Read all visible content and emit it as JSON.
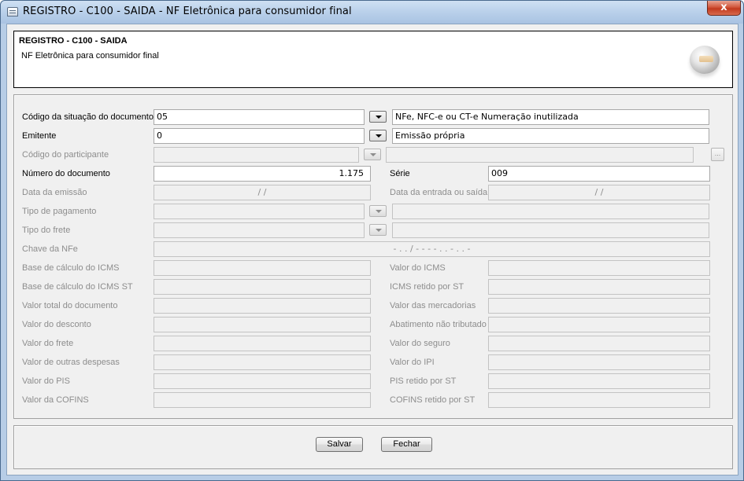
{
  "window": {
    "title": "REGISTRO - C100 - SAIDA - NF Eletrônica para consumidor final",
    "close_label": "x"
  },
  "header": {
    "title": "REGISTRO - C100 - SAIDA",
    "subtitle": "NF Eletrônica para consumidor final"
  },
  "form": {
    "situacao": {
      "label": "Código da situação do documento",
      "value": "05",
      "description": "NFe, NFC-e ou CT-e Numeração inutilizada"
    },
    "emitente": {
      "label": "Emitente",
      "value": "0",
      "description": "Emissão própria"
    },
    "participante": {
      "label": "Código do participante",
      "value": "",
      "description": "",
      "lookup_label": "..."
    },
    "numero": {
      "label": "Número do documento",
      "value": "1.175"
    },
    "serie": {
      "label": "Série",
      "value": "009"
    },
    "data_emissao": {
      "label": "Data da emissão",
      "value": "/ /"
    },
    "data_entrada": {
      "label": "Data da entrada ou saída",
      "value": "/ /"
    },
    "tipo_pagamento": {
      "label": "Tipo de pagamento",
      "value": "",
      "description": ""
    },
    "tipo_frete": {
      "label": "Tipo do frete",
      "value": "",
      "description": ""
    },
    "chave_nfe": {
      "label": "Chave da NFe",
      "value": "-   .   .   /   -   -   -   -   .   .   -   .   .   -"
    },
    "left_fields": [
      {
        "label": "Base de cálculo do ICMS",
        "value": ""
      },
      {
        "label": "Base de cálculo do ICMS ST",
        "value": ""
      },
      {
        "label": "Valor total do documento",
        "value": ""
      },
      {
        "label": "Valor do desconto",
        "value": ""
      },
      {
        "label": "Valor do frete",
        "value": ""
      },
      {
        "label": "Valor de outras despesas",
        "value": ""
      },
      {
        "label": "Valor do PIS",
        "value": ""
      },
      {
        "label": "Valor da COFINS",
        "value": ""
      }
    ],
    "right_fields": [
      {
        "label": "Valor do ICMS",
        "value": ""
      },
      {
        "label": "ICMS retido por ST",
        "value": ""
      },
      {
        "label": "Valor das mercadorias",
        "value": ""
      },
      {
        "label": "Abatimento não tributado",
        "value": ""
      },
      {
        "label": "Valor do seguro",
        "value": ""
      },
      {
        "label": "Valor do IPI",
        "value": ""
      },
      {
        "label": "PIS retido por ST",
        "value": ""
      },
      {
        "label": "COFINS retido por ST",
        "value": ""
      }
    ]
  },
  "buttons": {
    "save_label": "Salvar",
    "close_label": "Fechar"
  }
}
